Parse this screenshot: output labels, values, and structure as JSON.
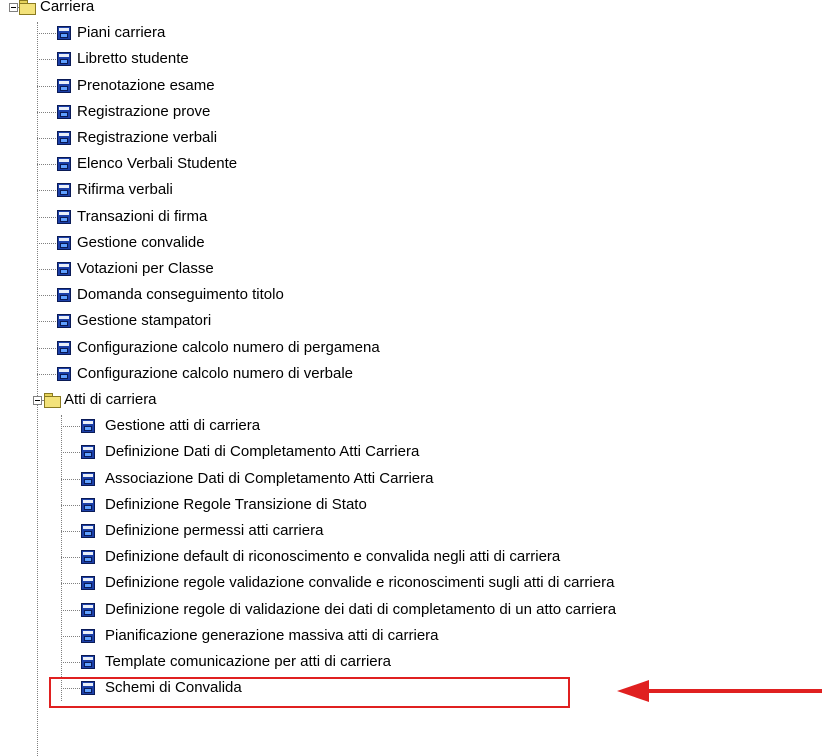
{
  "tree": {
    "root": {
      "label": "Carriera",
      "expanded": true
    },
    "root_items": [
      "Piani carriera",
      "Libretto studente",
      "Prenotazione esame",
      "Registrazione prove",
      "Registrazione verbali",
      "Elenco Verbali Studente",
      "Rifirma verbali",
      "Transazioni di firma",
      "Gestione convalide",
      "Votazioni per Classe",
      "Domanda conseguimento titolo",
      "Gestione stampatori",
      "Configurazione calcolo numero di pergamena",
      "Configurazione calcolo numero di verbale"
    ],
    "subfolder": {
      "label": "Atti di carriera",
      "expanded": true
    },
    "subfolder_items": [
      "Gestione atti di carriera",
      "Definizione Dati di Completamento Atti Carriera",
      "Associazione Dati di Completamento Atti Carriera",
      "Definizione Regole Transizione di Stato",
      "Definizione permessi atti carriera",
      "Definizione default di riconoscimento e convalida negli atti di carriera",
      "Definizione regole validazione convalide e riconoscimenti sugli atti di carriera",
      "Definizione regole di validazione dei dati di completamento di un atto carriera",
      "Pianificazione generazione massiva atti di carriera",
      "Template comunicazione per atti di carriera",
      "Schemi di Convalida"
    ],
    "highlighted_item": "Pianificazione generazione massiva atti di carriera"
  },
  "icons": {
    "folder": "folder-icon",
    "program": "program-icon",
    "expander": "collapse-toggle-icon",
    "arrow": "arrow-left-icon"
  },
  "colors": {
    "highlight": "#e02020",
    "program_icon": "#1b3fa8",
    "folder": "#f3e27a"
  }
}
